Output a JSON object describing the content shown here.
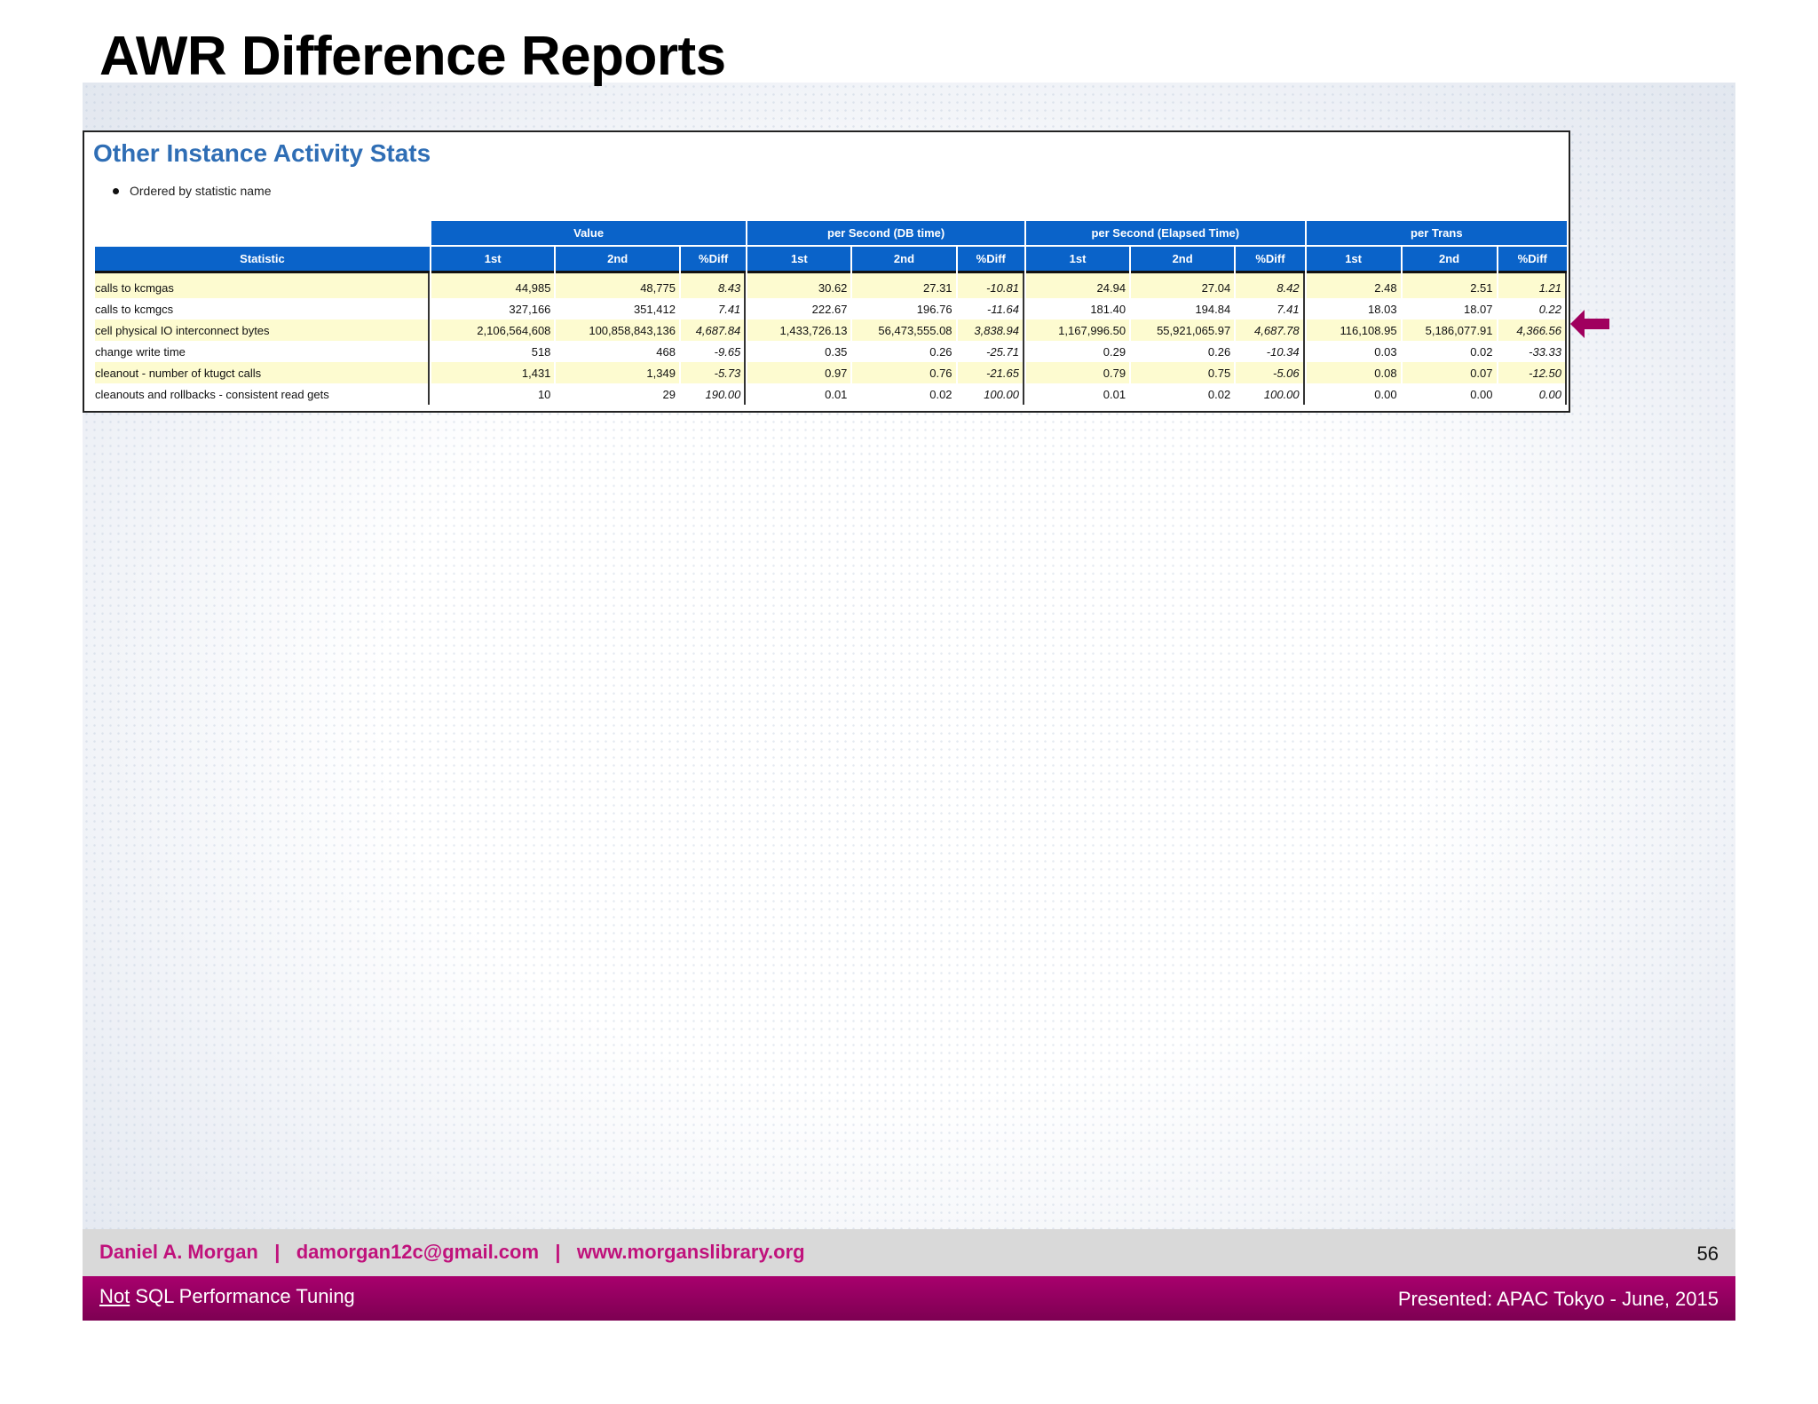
{
  "slide": {
    "title": "AWR Difference Reports",
    "page_number": "56"
  },
  "report": {
    "title": "Other Instance Activity Stats",
    "note": "Ordered by statistic name",
    "groups": [
      "Value",
      "per Second (DB time)",
      "per Second (Elapsed Time)",
      "per Trans"
    ],
    "columns": [
      "Statistic",
      "1st",
      "2nd",
      "%Diff",
      "1st",
      "2nd",
      "%Diff",
      "1st",
      "2nd",
      "%Diff",
      "1st",
      "2nd",
      "%Diff"
    ],
    "rows": [
      [
        "calls to kcmgas",
        "44,985",
        "48,775",
        "8.43",
        "30.62",
        "27.31",
        "-10.81",
        "24.94",
        "27.04",
        "8.42",
        "2.48",
        "2.51",
        "1.21"
      ],
      [
        "calls to kcmgcs",
        "327,166",
        "351,412",
        "7.41",
        "222.67",
        "196.76",
        "-11.64",
        "181.40",
        "194.84",
        "7.41",
        "18.03",
        "18.07",
        "0.22"
      ],
      [
        "cell physical IO interconnect bytes",
        "2,106,564,608",
        "100,858,843,136",
        "4,687.84",
        "1,433,726.13",
        "56,473,555.08",
        "3,838.94",
        "1,167,996.50",
        "55,921,065.97",
        "4,687.78",
        "116,108.95",
        "5,186,077.91",
        "4,366.56"
      ],
      [
        "change write time",
        "518",
        "468",
        "-9.65",
        "0.35",
        "0.26",
        "-25.71",
        "0.29",
        "0.26",
        "-10.34",
        "0.03",
        "0.02",
        "-33.33"
      ],
      [
        "cleanout - number of ktugct calls",
        "1,431",
        "1,349",
        "-5.73",
        "0.97",
        "0.76",
        "-21.65",
        "0.79",
        "0.75",
        "-5.06",
        "0.08",
        "0.07",
        "-12.50"
      ],
      [
        "cleanouts and rollbacks - consistent read gets",
        "10",
        "29",
        "190.00",
        "0.01",
        "0.02",
        "100.00",
        "0.01",
        "0.02",
        "100.00",
        "0.00",
        "0.00",
        "0.00"
      ]
    ]
  },
  "footer": {
    "author": "Daniel A. Morgan",
    "separator": "|",
    "email": "damorgan12c@gmail.com",
    "website": "www.morganslibrary.org",
    "course_prefix": "Not",
    "course_rest": " SQL Performance Tuning",
    "presented": "Presented: APAC Tokyo  - June, 2015"
  },
  "colors": {
    "accent_blue": "#0a63c9",
    "report_title_blue": "#2f6eb5",
    "brand_magenta": "#a8006d",
    "row_highlight": "#fdfbd0",
    "arrow": "#a0005e"
  },
  "icons": {
    "pointer": "left-arrow-icon"
  }
}
